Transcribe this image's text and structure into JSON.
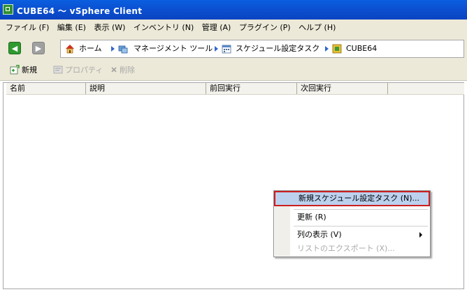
{
  "window": {
    "title": "CUBE64 ～ vSphere Client"
  },
  "menu": {
    "items": [
      "ファイル (F)",
      "編集 (E)",
      "表示 (W)",
      "インベントリ (N)",
      "管理 (A)",
      "プラグイン (P)",
      "ヘルプ (H)"
    ]
  },
  "breadcrumb": {
    "items": [
      "ホーム",
      "マネージメント ツール",
      "スケジュール設定タスク",
      "CUBE64"
    ]
  },
  "toolbar": {
    "new_label": "新規",
    "properties_label": "プロパティ",
    "delete_label": "削除"
  },
  "table": {
    "columns": [
      "名前",
      "説明",
      "前回実行",
      "次回実行"
    ]
  },
  "context_menu": {
    "items": [
      "新規スケジュール設定タスク (N)...",
      "更新 (R)",
      "列の表示 (V)",
      "リストのエクスポート (X)..."
    ]
  },
  "colors": {
    "titlebar": "#0b4fd0",
    "chrome": "#ece9d8",
    "highlight": "#bcd1ee",
    "highlight_border": "#cc2020"
  },
  "icons": {
    "app": "vsphere-app-icon",
    "back": "back-arrow-icon",
    "forward": "forward-arrow-icon",
    "home": "home-icon",
    "management": "management-tools-icon",
    "scheduled": "scheduled-tasks-icon",
    "host": "host-icon",
    "new": "new-task-icon",
    "properties": "properties-icon",
    "delete": "delete-icon"
  }
}
